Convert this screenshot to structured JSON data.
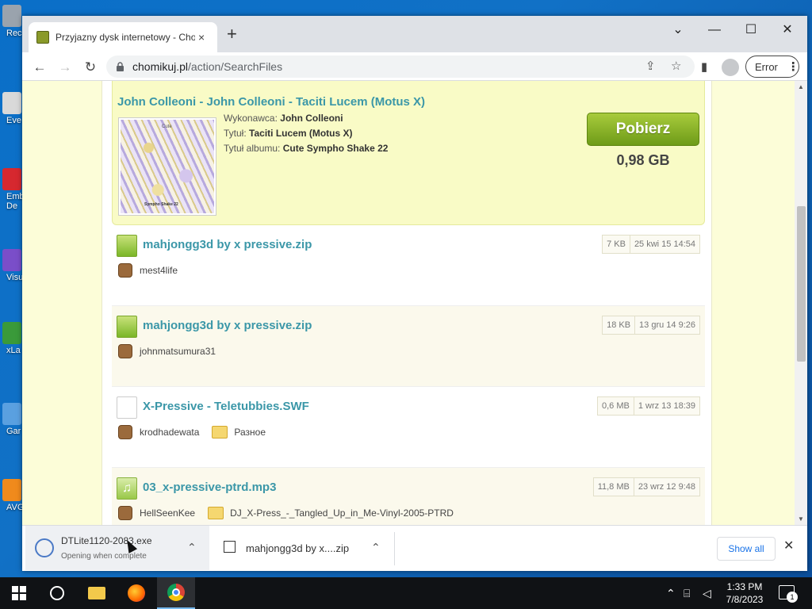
{
  "desktop": {
    "icons": [
      {
        "label": "Rec",
        "color": "#9aa3ad"
      },
      {
        "label": "Eve",
        "color": "#d9d9d9"
      },
      {
        "label": "Emb\nDe",
        "color": "#d6282f"
      },
      {
        "label": "Visu",
        "color": "#7a4ec9"
      },
      {
        "label": "xLa",
        "color": "#3a9a3a"
      },
      {
        "label": "Gar",
        "color": "#5aa0e0"
      },
      {
        "label": "AVG",
        "color": "#f08a1c"
      }
    ]
  },
  "browser": {
    "tab_title": "Przyjazny dysk internetowy - Chomikuj",
    "tab_close": "×",
    "new_tab": "+",
    "win_minimize": "—",
    "win_maximize": "☐",
    "win_close": "✕",
    "win_dropdown": "⌄",
    "url_host": "chomikuj.pl",
    "url_path": "/action/SearchFiles",
    "error_label": "Error"
  },
  "featured": {
    "title": "John Colleoni - John Colleoni - Taciti Lucem (Motus X)",
    "cover_top_text": "Cute",
    "cover_bottom_text": "Sympho Shake 22",
    "artist_label": "Wykonawca:",
    "artist": "John Colleoni",
    "track_label": "Tytuł:",
    "track": "Taciti Lucem (Motus X)",
    "album_label": "Tytuł albumu:",
    "album": "Cute Sympho Shake 22",
    "download_button": "Pobierz",
    "size": "0,98 GB"
  },
  "files": [
    {
      "name": "mahjongg3d by x pressive.zip",
      "size": "7 KB",
      "date": "25 kwi 15 14:54",
      "owner": "mest4life",
      "folder": "",
      "type": "zip"
    },
    {
      "name": "mahjongg3d by x pressive.zip",
      "size": "18 KB",
      "date": "13 gru 14 9:26",
      "owner": "johnmatsumura31",
      "folder": "",
      "type": "zip"
    },
    {
      "name": "X-Pressive - Teletubbies.SWF",
      "size": "0,6 MB",
      "date": "1 wrz 13 18:39",
      "owner": "krodhadewata",
      "folder": "Разное",
      "type": "blank"
    },
    {
      "name": "03_x-pressive-ptrd.mp3",
      "size": "11,8 MB",
      "date": "23 wrz 12 9:48",
      "owner": "HellSeenKee",
      "folder": "DJ_X-Press_-_Tangled_Up_in_Me-Vinyl-2005-PTRD",
      "type": "mp3"
    }
  ],
  "downloads": {
    "item1_name": "DTLite1120-2083.exe",
    "item1_status": "Opening when complete",
    "item2_name": "mahjongg3d by x....zip",
    "show_all": "Show all",
    "close": "✕"
  },
  "taskbar": {
    "time": "1:33 PM",
    "date": "7/8/2023",
    "notification_count": "1"
  }
}
